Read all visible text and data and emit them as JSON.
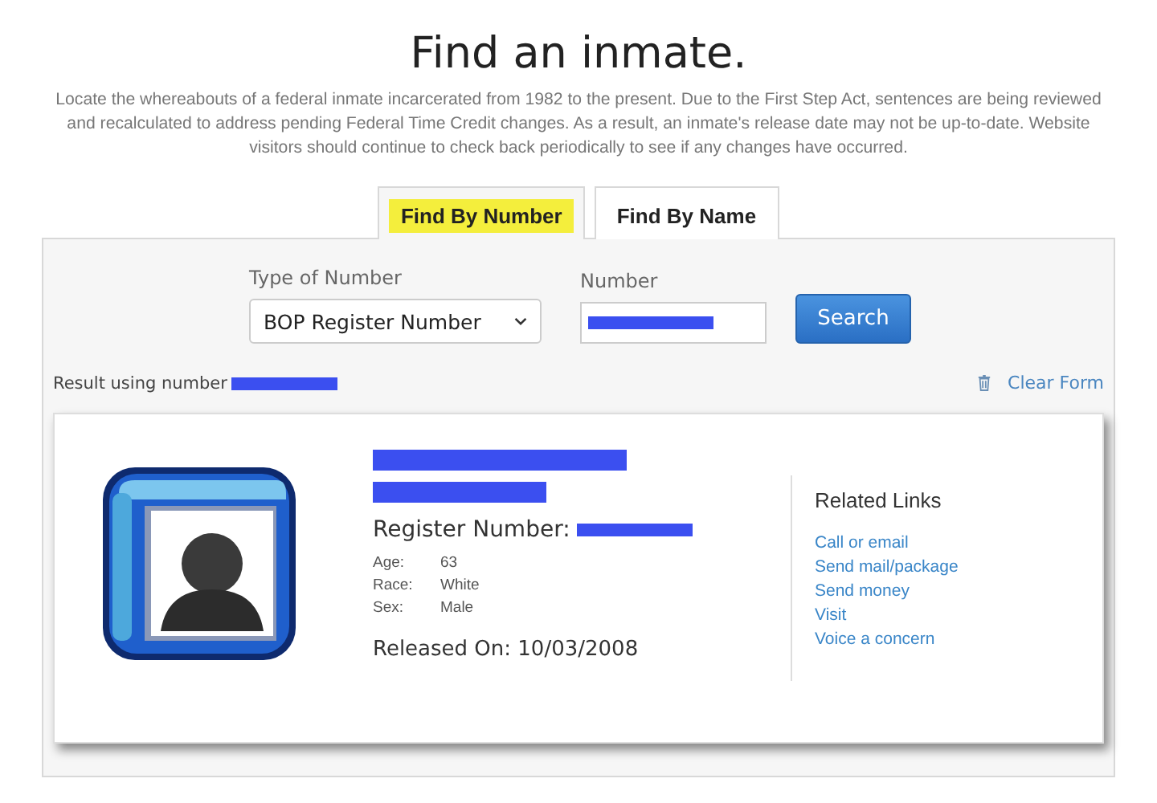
{
  "title": "Find an inmate.",
  "intro": "Locate the whereabouts of a federal inmate incarcerated from 1982 to the present. Due to the First Step Act, sentences are being reviewed and recalculated to address pending Federal Time Credit changes. As a result, an inmate's release date may not be up-to-date. Website visitors should continue to check back periodically to see if any changes have occurred.",
  "tabs": [
    {
      "label": "Find By Number",
      "selected": true
    },
    {
      "label": "Find By Name",
      "selected": false
    }
  ],
  "form": {
    "type_label": "Type of Number",
    "type_value": "BOP Register Number",
    "number_label": "Number",
    "search_button": "Search"
  },
  "result": {
    "label": "Result using number",
    "clear_form": "Clear Form"
  },
  "record": {
    "register_label": "Register Number:",
    "details": [
      {
        "label": "Age:",
        "value": "63"
      },
      {
        "label": "Race:",
        "value": "White"
      },
      {
        "label": "Sex:",
        "value": "Male"
      }
    ],
    "released": "Released On: 10/03/2008",
    "related_links": {
      "title": "Related Links",
      "links": [
        "Call or email",
        "Send mail/package",
        "Send money",
        "Visit",
        "Voice a concern"
      ]
    }
  }
}
